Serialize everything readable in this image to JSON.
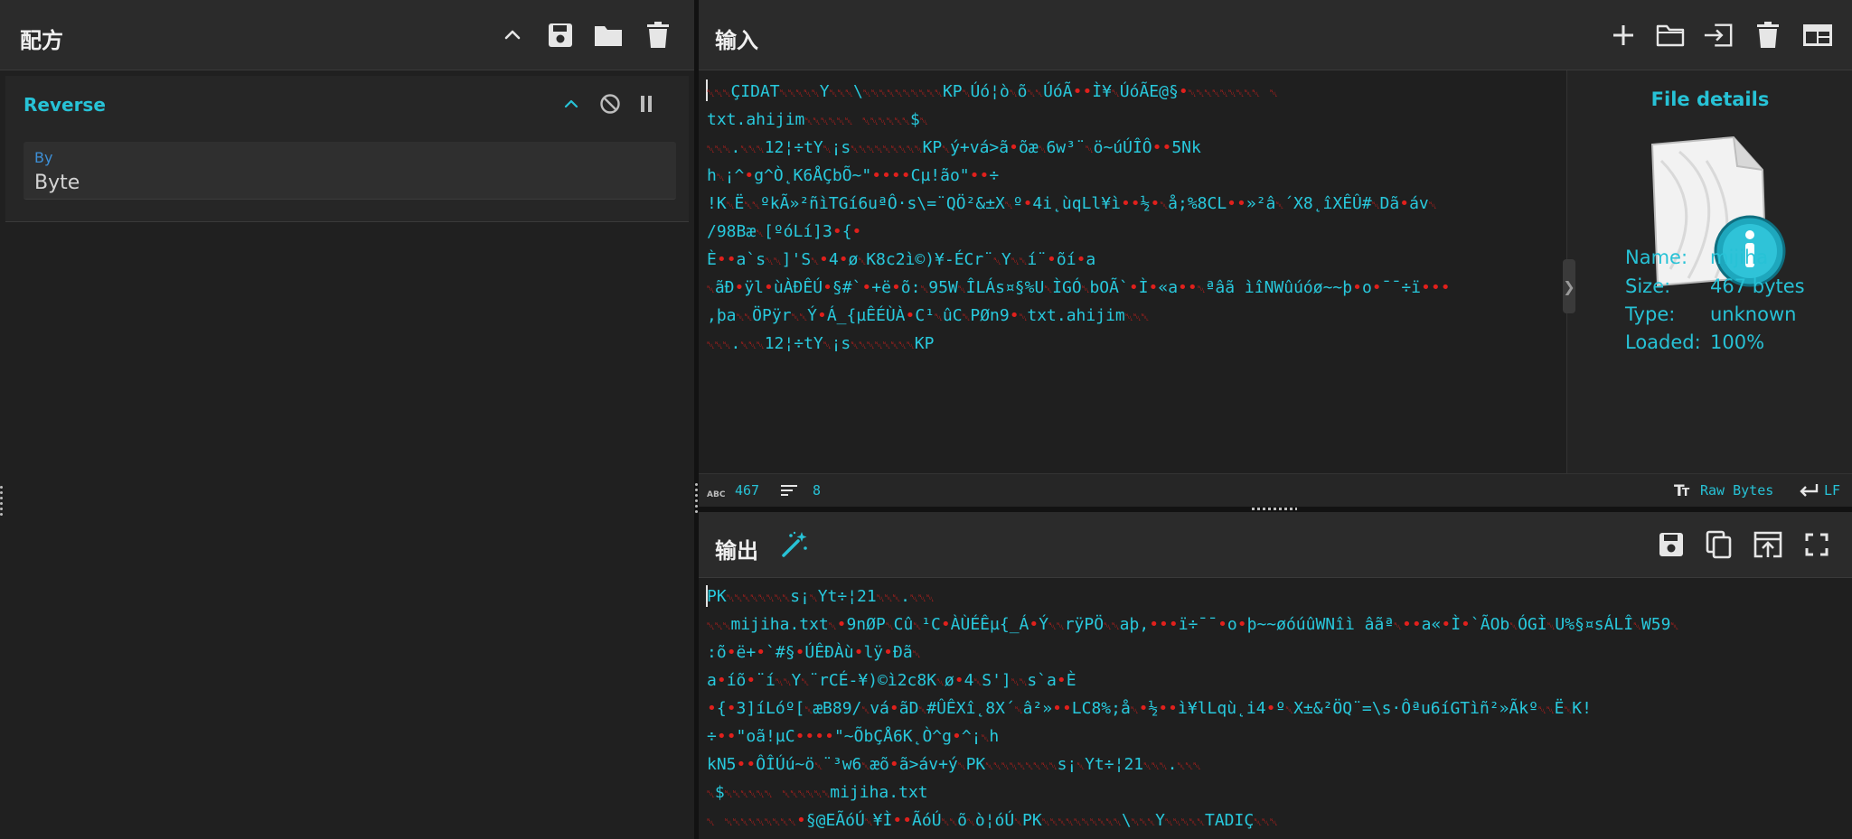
{
  "recipe": {
    "title": "配方",
    "header_icons": [
      "chevron-up-icon",
      "save-icon",
      "folder-icon",
      "trash-icon"
    ],
    "operation": {
      "name": "Reverse",
      "controls": [
        "chevron-up-icon",
        "disable-icon",
        "pause-icon"
      ],
      "arg_label": "By",
      "arg_value": "Byte"
    }
  },
  "input": {
    "title": "输入",
    "header_icons": [
      "plus-icon",
      "folder-icon",
      "import-icon",
      "trash-icon",
      "layout-icon"
    ],
    "lines": [
      "␀␀␀ÇIDAT␀␀␀␀␀Y␀␀␀\\␀␀␀␀␀␀␀␀␀␀KP␀Úó¦ò␀õ␀␀ÚóÃ••Ì¥␀ÚóÃE@§•␀␀␀␀␀␀␀␀␀ ␀",
      "txt.ahijim␀␀␀␀␀␀ ␀␀␀␀␀␀$␀",
      "␀␀␀.␀␀␀12¦÷tY␀¡s␀␀␀␀␀␀␀␀␀KP␀ý+vá>ã•õæ␀6w³¨␀ö~úÚÎÔ••5Nk",
      "h␀¡^•g^Ò˛K6ÅÇbÕ~\"••••Cµ!ão\"••÷",
      "!K␀Ë␀␀ºkÃ»²ñìTGí6uªÔ·s\\=¨QÖ²&±X␀º•4i˛ùqLl¥ì••½•␀å;%8CL••»²â␀´X8˛îXÊÛ#␀Dã•áv␀",
      "/98Bæ␀[ºóLí]3•{•",
      "È••a`s␀␀]'S␀•4•ø␀K8c2ì©)¥-ÉCr¨␀Y␀␀í¨•õí•a",
      "␀ãÐ•ÿl•ùÀÐÊÚ•§#`•+ë•õ:␀95W␀ÎLÁs¤§%U␀ÌGÓ␀bOÃ`•Ì•«a••␀ªâã ìîNWûúóø~~þ•o•¯¯÷ï•••",
      ",þa␀␀ÖPÿr␀␀Ý•Á_{µÊÉÙÀ•C¹␀ûC␀PØn9•␀txt.ahijim␀␀␀",
      "␀␀␀.␀␀␀12¦÷tY␀¡s␀␀␀␀␀␀␀␀KP"
    ],
    "file_details": {
      "title": "File details",
      "icon": "file-info-icon",
      "name_label": "Name:",
      "name": "mijiha",
      "size_label": "Size:",
      "size": "467 bytes",
      "type_label": "Type:",
      "type": "unknown",
      "loaded_label": "Loaded:",
      "loaded": "100%"
    },
    "status": {
      "length_icon": "abc-icon",
      "length": "467",
      "lines_icon": "lines-icon",
      "lines": "8",
      "encoding_icon": "text-format-icon",
      "encoding": "Raw Bytes",
      "eol_icon": "return-icon",
      "eol": "LF"
    }
  },
  "output": {
    "title": "输出",
    "magic_icon": "magic-wand-icon",
    "header_icons": [
      "save-icon",
      "copy-icon",
      "replace-input-icon",
      "maximise-icon"
    ],
    "lines": [
      "PK␀␀␀␀␀␀␀␀s¡␀Yt÷¦21␀␀␀.␀␀␀",
      "␀␀␀mijiha.txt␀•9nØP␀Cû␀¹C•ÀÙÉÊµ{_Á•Ý␀␀rÿPÖ␀␀aþ,•••ï÷¯¯•o•þ~~øóúûWNîì âãª␀••a«•Ì•`ÃOb␀ÓGÌ␀U%§¤sÁLÎ␀W59␀",
      ":õ•ë+•`#§•ÚÊÐÀù•lÿ•Ðã␀",
      "a•íõ•¨í␀␀Y␀¨rCÉ-¥)©ì2c8K␀ø•4␀S']␀␀s`a•È",
      "•{•3]íLóº[␀æB89/␀vá•ãD␀#ÛÊXî˛8X´␀â²»••LC8%;å␀•½••ì¥lLqù˛i4•º␀X±&²ÖQ¨=\\s·Ôªu6íGTìñ²»Ãkº␀␀Ë␀K!",
      "÷••\"oã!µC••••\"~ÕbÇÅ6K˛Ò^g•^¡␀h",
      "kN5••ÔÎÚú~ö␀¨³w6␀æõ•ã>áv+ý␀PK␀␀␀␀␀␀␀␀␀s¡␀Yt÷¦21␀␀␀.␀␀␀",
      "␀$␀␀␀␀␀␀ ␀␀␀␀␀␀mijiha.txt",
      "␀ ␀␀␀␀␀␀␀␀␀•§@EÃóÚ␀¥Ì••ÃóÚ␀␀õ␀ò¦óÚ␀PK␀␀␀␀␀␀␀␀␀␀\\␀␀␀Y␀␀␀␀␀TADIÇ␀␀␀"
    ]
  },
  "colors": {
    "accent": "#27c2d6",
    "nonprintable": "#e0201c",
    "background": "#1f1f1f",
    "header": "#2b2b2b"
  }
}
